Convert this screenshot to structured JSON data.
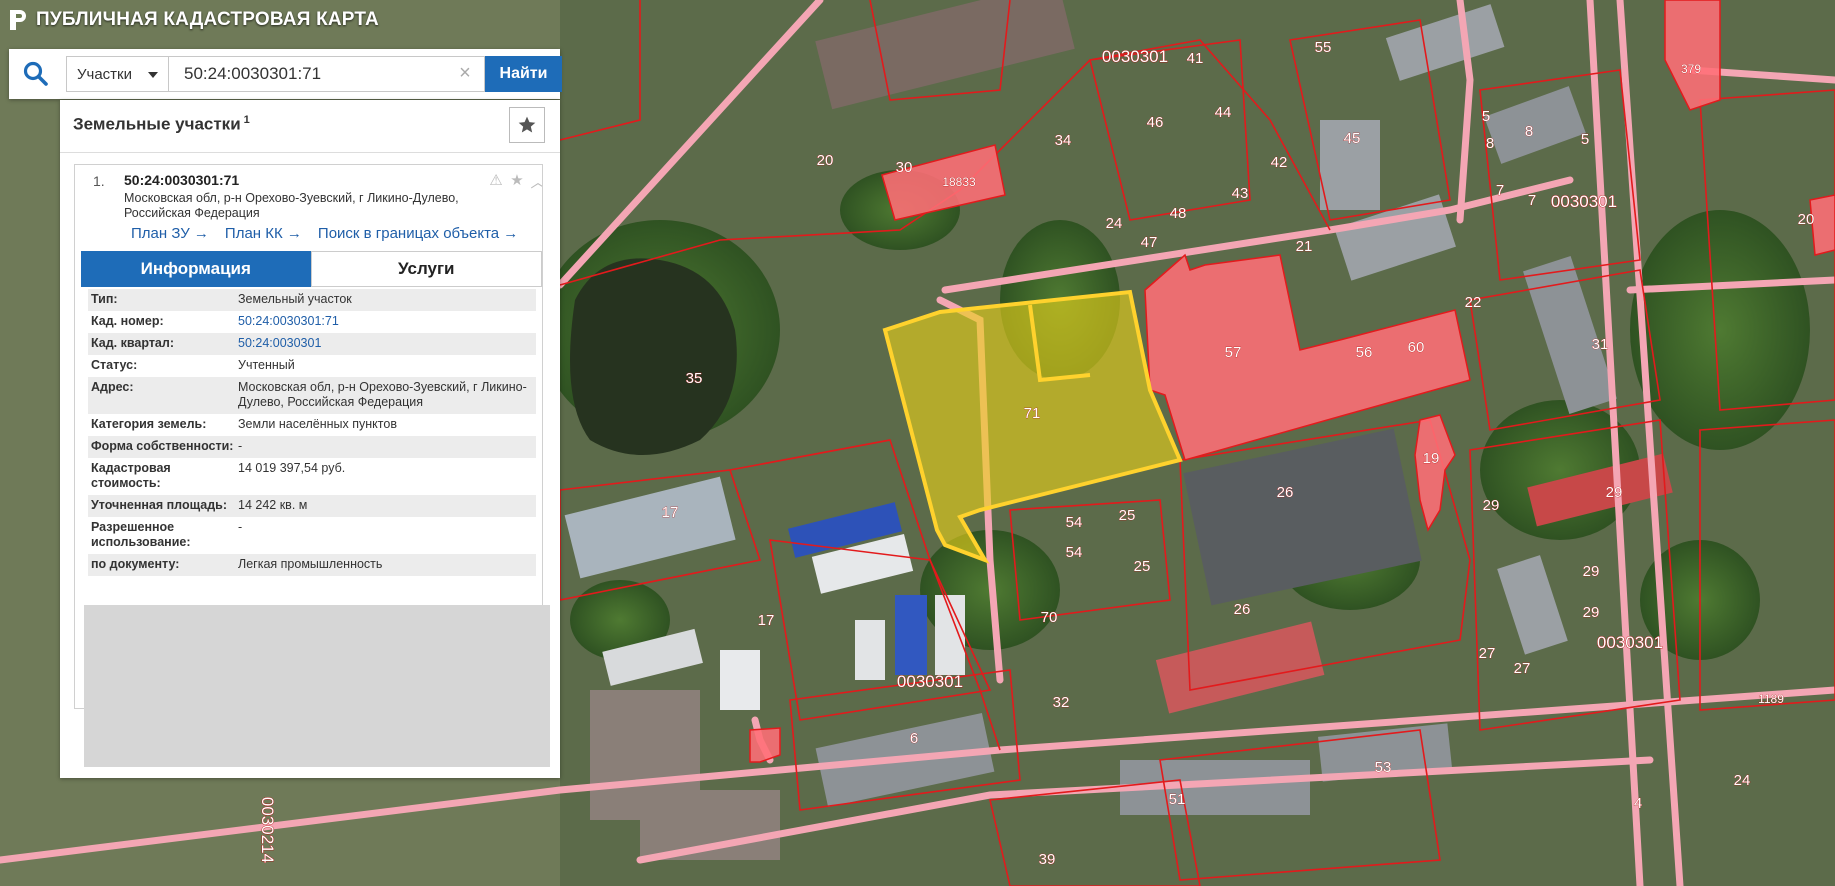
{
  "app": {
    "title": "ПУБЛИЧНАЯ КАДАСТРОВАЯ КАРТА"
  },
  "search": {
    "type_label": "Участки",
    "value": "50:24:0030301:71",
    "clear_symbol": "×",
    "button_label": "Найти"
  },
  "panel": {
    "title": "Земельные участки",
    "count": "1",
    "result": {
      "number": "1.",
      "cad_number": "50:24:0030301:71",
      "address": "Московская обл, р-н Орехово-Зуевский, г Ликино-Дулево, Российская Федерация",
      "links": [
        "План ЗУ →",
        "План КК →",
        "Поиск в границах объекта →"
      ],
      "tabs": [
        "Информация",
        "Услуги"
      ],
      "properties": [
        {
          "key": "Тип:",
          "value": "Земельный участок",
          "link": false
        },
        {
          "key": "Кад. номер:",
          "value": "50:24:0030301:71",
          "link": true
        },
        {
          "key": "Кад. квартал:",
          "value": "50:24:0030301",
          "link": true
        },
        {
          "key": "Статус:",
          "value": "Учтенный",
          "link": false
        },
        {
          "key": "Адрес:",
          "value": "Московская обл, р-н Орехово-Зуевский, г Ликино-Дулево, Российская Федерация",
          "link": false
        },
        {
          "key": "Категория земель:",
          "value": "Земли населённых пунктов",
          "link": false
        },
        {
          "key": "Форма собственности:",
          "value": "-",
          "link": false
        },
        {
          "key": "Кадастровая стоимость:",
          "value": "14 019 397,54 руб.",
          "link": false
        },
        {
          "key": "Уточненная площадь:",
          "value": "14 242 кв. м",
          "link": false
        },
        {
          "key": "Разрешенное использование:",
          "value": "-",
          "link": false
        },
        {
          "key": "по документу:",
          "value": "Легкая промышленность",
          "link": false
        }
      ]
    }
  },
  "map": {
    "quarter_labels": [
      "0030301",
      "0030301",
      "0030301",
      "0030301",
      "0030214"
    ],
    "parcel_labels": [
      "71",
      "57",
      "56",
      "60",
      "26",
      "26",
      "21",
      "31",
      "19",
      "29",
      "29",
      "29",
      "29",
      "27",
      "27",
      "17",
      "17",
      "35",
      "20",
      "30",
      "18833",
      "34",
      "46",
      "41",
      "44",
      "42",
      "43",
      "45",
      "55",
      "5",
      "5",
      "8",
      "8",
      "7",
      "7",
      "24",
      "48",
      "47",
      "22",
      "54",
      "54",
      "25",
      "25",
      "70",
      "32",
      "6",
      "53",
      "51",
      "4",
      "24",
      "39",
      "379",
      "20",
      "1189",
      "60"
    ],
    "colors": {
      "selected": "#e8d21a",
      "building": "#ff6e76",
      "border": "#e31a1c",
      "road": "#f4a6b4"
    }
  }
}
